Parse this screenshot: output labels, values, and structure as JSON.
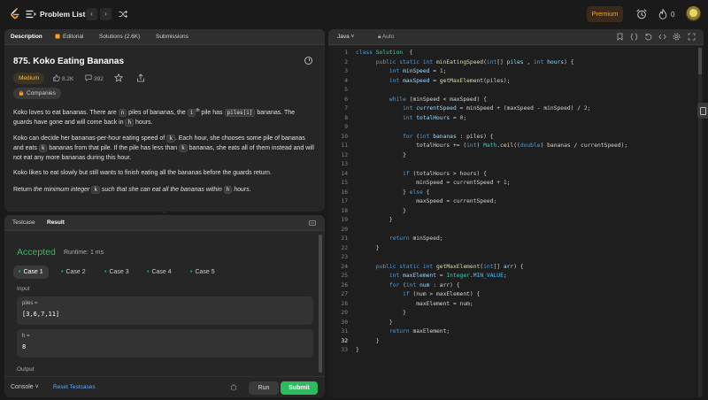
{
  "header": {
    "title": "Problem List",
    "premium_label": "Premium",
    "streak_count": "0"
  },
  "description": {
    "tabs": [
      "Description",
      "Editorial",
      "Solutions (2.6K)",
      "Submissions"
    ],
    "title": "875. Koko Eating Bananas",
    "difficulty": "Medium",
    "likes": "8.2K",
    "comments": "392",
    "companies_label": "Companies",
    "p1": [
      {
        "t": "Koko loves to eat bananas. There are "
      },
      {
        "t": "n",
        "c": true
      },
      {
        "t": " piles of bananas, the "
      },
      {
        "t": "i",
        "c": true
      },
      {
        "t": "th",
        "sup": true
      },
      {
        "t": " pile has "
      },
      {
        "t": "piles[i]",
        "c": true
      },
      {
        "t": " bananas. The guards have gone and will come back in "
      },
      {
        "t": "h",
        "c": true
      },
      {
        "t": " hours."
      }
    ],
    "p2": [
      {
        "t": "Koko can decide her bananas-per-hour eating speed of "
      },
      {
        "t": "k",
        "c": true
      },
      {
        "t": ". Each hour, she chooses some pile of bananas and eats "
      },
      {
        "t": "k",
        "c": true
      },
      {
        "t": " bananas from that pile. If the pile has less than "
      },
      {
        "t": "k",
        "c": true
      },
      {
        "t": " bananas, she eats all of them instead and will not eat any more bananas during this hour."
      }
    ],
    "p3": [
      {
        "t": "Koko likes to eat slowly but still wants to finish eating all the bananas before the guards return."
      }
    ],
    "p4": [
      {
        "t": "Return "
      },
      {
        "t": "the minimum integer ",
        "i": true
      },
      {
        "t": "k",
        "c": true
      },
      {
        "t": " such that she can eat all the bananas within ",
        "i": true
      },
      {
        "t": "h",
        "c": true
      },
      {
        "t": " hours",
        "i": true
      },
      {
        "t": "."
      }
    ]
  },
  "result": {
    "tabs": [
      "Testcase",
      "Result"
    ],
    "status": "Accepted",
    "runtime": "Runtime: 1 ms",
    "cases": [
      "Case 1",
      "Case 2",
      "Case 3",
      "Case 4",
      "Case 5"
    ],
    "input_label": "Input",
    "output_label": "Output",
    "inputs": [
      {
        "name": "piles =",
        "value": "[3,6,7,11]"
      },
      {
        "name": "h =",
        "value": "8"
      }
    ],
    "console_label": "Console",
    "reset_label": "Reset Testcases",
    "run_label": "Run",
    "submit_label": "Submit"
  },
  "editor": {
    "language": "Java",
    "mode": "Auto",
    "current_line": 32,
    "lines": [
      [
        [
          "kw",
          "class "
        ],
        [
          "ty",
          "Solution"
        ],
        [
          "",
          "  {"
        ]
      ],
      [
        [
          "",
          "      "
        ],
        [
          "kw",
          "public static int "
        ],
        [
          "fn",
          "minEatingSpeed"
        ],
        [
          "",
          "("
        ],
        [
          "kw",
          "int"
        ],
        [
          "",
          "[] "
        ],
        [
          "va",
          "piles"
        ],
        [
          "",
          " , "
        ],
        [
          "kw",
          "int "
        ],
        [
          "va",
          "hours"
        ],
        [
          "",
          ") {"
        ]
      ],
      [
        [
          "",
          "          "
        ],
        [
          "kw",
          "int "
        ],
        [
          "va",
          "minSpeed"
        ],
        [
          "",
          " = "
        ],
        [
          "nu",
          "1"
        ],
        [
          "",
          ";"
        ]
      ],
      [
        [
          "",
          "          "
        ],
        [
          "kw",
          "int "
        ],
        [
          "va",
          "maxSpeed"
        ],
        [
          "",
          " = "
        ],
        [
          "fn",
          "getMaxElement"
        ],
        [
          "",
          "(piles);"
        ]
      ],
      [
        [
          "",
          ""
        ]
      ],
      [
        [
          "",
          "          "
        ],
        [
          "kw",
          "while "
        ],
        [
          "",
          "(minSpeed < maxSpeed) {"
        ]
      ],
      [
        [
          "",
          "              "
        ],
        [
          "kw",
          "int "
        ],
        [
          "va",
          "currentSpeed"
        ],
        [
          "",
          " = minSpeed + (maxSpeed - minSpeed) / "
        ],
        [
          "nu",
          "2"
        ],
        [
          "",
          ";"
        ]
      ],
      [
        [
          "",
          "              "
        ],
        [
          "kw",
          "int "
        ],
        [
          "va",
          "totalHours"
        ],
        [
          "",
          " = "
        ],
        [
          "nu",
          "0"
        ],
        [
          "",
          ";"
        ]
      ],
      [
        [
          "",
          ""
        ]
      ],
      [
        [
          "",
          "              "
        ],
        [
          "kw",
          "for "
        ],
        [
          "",
          "("
        ],
        [
          "kw",
          "int "
        ],
        [
          "va",
          "bananas"
        ],
        [
          "",
          " : piles) {"
        ]
      ],
      [
        [
          "",
          "                  totalHours += ("
        ],
        [
          "kw",
          "int"
        ],
        [
          "",
          ") "
        ],
        [
          "ty",
          "Math"
        ],
        [
          "",
          "."
        ],
        [
          "fn",
          "ceil"
        ],
        [
          "",
          "(("
        ],
        [
          "kw",
          "double"
        ],
        [
          "",
          ") bananas / currentSpeed);"
        ]
      ],
      [
        [
          "",
          "              }"
        ]
      ],
      [
        [
          "",
          ""
        ]
      ],
      [
        [
          "",
          "              "
        ],
        [
          "kw",
          "if "
        ],
        [
          "",
          "(totalHours > hours) {"
        ]
      ],
      [
        [
          "",
          "                  minSpeed = currentSpeed + "
        ],
        [
          "nu",
          "1"
        ],
        [
          "",
          ";"
        ]
      ],
      [
        [
          "",
          "              } "
        ],
        [
          "kw",
          "else "
        ],
        [
          "",
          "{"
        ]
      ],
      [
        [
          "",
          "                  maxSpeed = currentSpeed;"
        ]
      ],
      [
        [
          "",
          "              }"
        ]
      ],
      [
        [
          "",
          "          }"
        ]
      ],
      [
        [
          "",
          ""
        ]
      ],
      [
        [
          "",
          "          "
        ],
        [
          "kw",
          "return "
        ],
        [
          "",
          "minSpeed;"
        ]
      ],
      [
        [
          "",
          "      }"
        ]
      ],
      [
        [
          "",
          ""
        ]
      ],
      [
        [
          "",
          "      "
        ],
        [
          "kw",
          "public static int "
        ],
        [
          "fn",
          "getMaxElement"
        ],
        [
          "",
          "("
        ],
        [
          "kw",
          "int"
        ],
        [
          "",
          "[] "
        ],
        [
          "va",
          "arr"
        ],
        [
          "",
          ") {"
        ]
      ],
      [
        [
          "",
          "          "
        ],
        [
          "kw",
          "int "
        ],
        [
          "va",
          "maxElement"
        ],
        [
          "",
          " = "
        ],
        [
          "ty",
          "Integer"
        ],
        [
          "",
          "."
        ],
        [
          "co",
          "MIN_VALUE"
        ],
        [
          "",
          ";"
        ]
      ],
      [
        [
          "",
          "          "
        ],
        [
          "kw",
          "for "
        ],
        [
          "",
          "("
        ],
        [
          "kw",
          "int "
        ],
        [
          "va",
          "num"
        ],
        [
          "",
          " : arr) {"
        ]
      ],
      [
        [
          "",
          "              "
        ],
        [
          "kw",
          "if "
        ],
        [
          "",
          "(num > maxElement) {"
        ]
      ],
      [
        [
          "",
          "                  maxElement = num;"
        ]
      ],
      [
        [
          "",
          "              }"
        ]
      ],
      [
        [
          "",
          "          }"
        ]
      ],
      [
        [
          "",
          "          "
        ],
        [
          "kw",
          "return "
        ],
        [
          "",
          "maxElement;"
        ]
      ],
      [
        [
          "",
          "      }"
        ]
      ],
      [
        [
          "",
          "}"
        ]
      ]
    ]
  }
}
